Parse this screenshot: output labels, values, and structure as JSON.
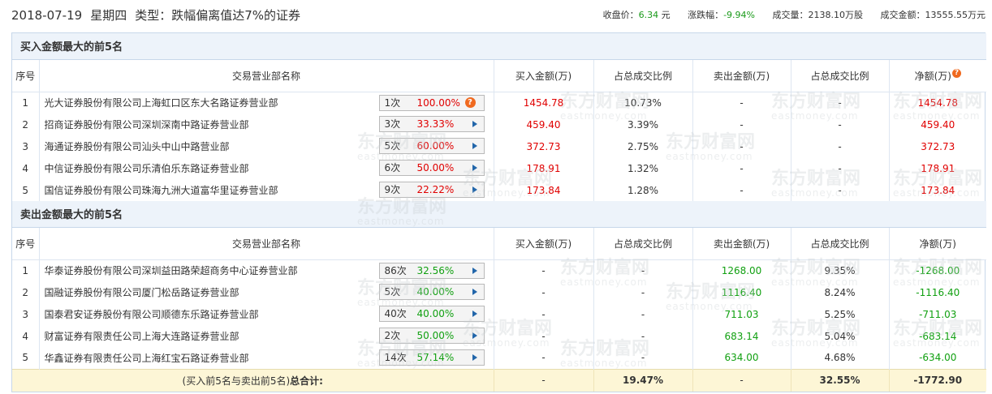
{
  "header": {
    "date": "2018-07-19",
    "weekday": "星期四",
    "type_label": "类型：",
    "type_value": "跌幅偏离值达7%的证券",
    "close_label": "收盘价：",
    "close_value": "6.34",
    "close_unit": "元",
    "change_label": "涨跌幅：",
    "change_value": "-9.94%",
    "volume_label": "成交量：",
    "volume_value": "2138.10万股",
    "amount_label": "成交金额：",
    "amount_value": "13555.55万元"
  },
  "columns": {
    "index": "序号",
    "name": "交易营业部名称",
    "buy": "买入金额(万)",
    "buy_ratio": "占总成交比例",
    "sell": "卖出金额(万)",
    "sell_ratio": "占总成交比例",
    "net": "净额(万)"
  },
  "buy_section": {
    "title": "买入金额最大的前5名",
    "rows": [
      {
        "idx": "1",
        "name": "光大证券股份有限公司上海虹口区东大名路证券营业部",
        "times": "1次",
        "pct": "100.00%",
        "buy": "1454.78",
        "buy_ratio": "10.73%",
        "sell": "-",
        "sell_ratio": "-",
        "net": "1454.78"
      },
      {
        "idx": "2",
        "name": "招商证券股份有限公司深圳深南中路证券营业部",
        "times": "3次",
        "pct": "33.33%",
        "buy": "459.40",
        "buy_ratio": "3.39%",
        "sell": "-",
        "sell_ratio": "-",
        "net": "459.40"
      },
      {
        "idx": "3",
        "name": "海通证券股份有限公司汕头中山中路营业部",
        "times": "5次",
        "pct": "60.00%",
        "buy": "372.73",
        "buy_ratio": "2.75%",
        "sell": "-",
        "sell_ratio": "-",
        "net": "372.73"
      },
      {
        "idx": "4",
        "name": "中信证券股份有限公司乐清伯乐东路证券营业部",
        "times": "6次",
        "pct": "50.00%",
        "buy": "178.91",
        "buy_ratio": "1.32%",
        "sell": "-",
        "sell_ratio": "-",
        "net": "178.91"
      },
      {
        "idx": "5",
        "name": "国信证券股份有限公司珠海九洲大道富华里证券营业部",
        "times": "9次",
        "pct": "22.22%",
        "buy": "173.84",
        "buy_ratio": "1.28%",
        "sell": "-",
        "sell_ratio": "-",
        "net": "173.84"
      }
    ]
  },
  "sell_section": {
    "title": "卖出金额最大的前5名",
    "rows": [
      {
        "idx": "1",
        "name": "华泰证券股份有限公司深圳益田路荣超商务中心证券营业部",
        "times": "86次",
        "pct": "32.56%",
        "buy": "-",
        "buy_ratio": "-",
        "sell": "1268.00",
        "sell_ratio": "9.35%",
        "net": "-1268.00"
      },
      {
        "idx": "2",
        "name": "国融证券股份有限公司厦门松岳路证券营业部",
        "times": "5次",
        "pct": "40.00%",
        "buy": "-",
        "buy_ratio": "-",
        "sell": "1116.40",
        "sell_ratio": "8.24%",
        "net": "-1116.40"
      },
      {
        "idx": "3",
        "name": "国泰君安证券股份有限公司顺德东乐路证券营业部",
        "times": "40次",
        "pct": "40.00%",
        "buy": "-",
        "buy_ratio": "-",
        "sell": "711.03",
        "sell_ratio": "5.25%",
        "net": "-711.03"
      },
      {
        "idx": "4",
        "name": "财富证券有限责任公司上海大连路证券营业部",
        "times": "2次",
        "pct": "50.00%",
        "buy": "-",
        "buy_ratio": "-",
        "sell": "683.14",
        "sell_ratio": "5.04%",
        "net": "-683.14"
      },
      {
        "idx": "5",
        "name": "华鑫证券有限责任公司上海红宝石路证券营业部",
        "times": "14次",
        "pct": "57.14%",
        "buy": "-",
        "buy_ratio": "-",
        "sell": "634.00",
        "sell_ratio": "4.68%",
        "net": "-634.00"
      }
    ]
  },
  "total": {
    "label_prefix": "(买入前5名与卖出前5名)",
    "label_bold": "总合计:",
    "buy": "-",
    "buy_ratio": "19.47%",
    "sell": "-",
    "sell_ratio": "32.55%",
    "net": "-1772.90"
  },
  "watermark": {
    "cn": "东方财富网",
    "en": "eastmoney.com"
  },
  "colors": {
    "positive": "#e00000",
    "negative": "#11a011",
    "header_bg": "#edf3fa",
    "total_bg": "#fdf6d6"
  }
}
